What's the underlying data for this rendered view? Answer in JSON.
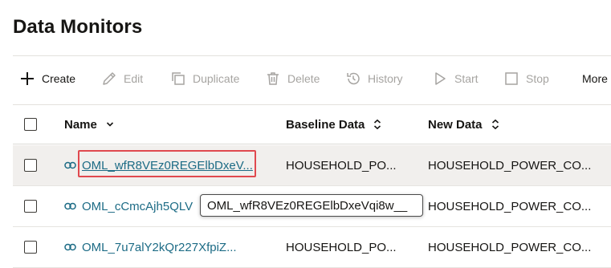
{
  "page": {
    "title": "Data Monitors"
  },
  "toolbar": {
    "create": {
      "label": "Create",
      "icon": "plus-icon"
    },
    "edit": {
      "label": "Edit",
      "icon": "pencil-icon"
    },
    "duplicate": {
      "label": "Duplicate",
      "icon": "duplicate-icon"
    },
    "delete": {
      "label": "Delete",
      "icon": "trash-icon"
    },
    "history": {
      "label": "History",
      "icon": "history-icon"
    },
    "start": {
      "label": "Start",
      "icon": "play-icon"
    },
    "stop": {
      "label": "Stop",
      "icon": "stop-icon"
    },
    "more": {
      "label": "More"
    }
  },
  "table": {
    "columns": {
      "name": "Name",
      "baseline": "Baseline Data",
      "new_data": "New Data"
    },
    "rows": [
      {
        "name": "OML_wfR8VEz0REGElbDxeV...",
        "baseline": "HOUSEHOLD_PO...",
        "new_data": "HOUSEHOLD_POWER_CO..."
      },
      {
        "name": "OML_cCmcAjh5QLV",
        "baseline": "",
        "new_data": "HOUSEHOLD_POWER_CO..."
      },
      {
        "name": "OML_7u7alY2kQr227XfpiZ...",
        "baseline": "HOUSEHOLD_PO...",
        "new_data": "HOUSEHOLD_POWER_CO..."
      }
    ]
  },
  "tooltip": {
    "text": "OML_wfR8VEz0REGElbDxeVqi8w__"
  },
  "colors": {
    "link": "#1c6b85",
    "highlight": "#e0494f",
    "disabled": "#a6a4a1",
    "selected_row": "#f1efed"
  }
}
